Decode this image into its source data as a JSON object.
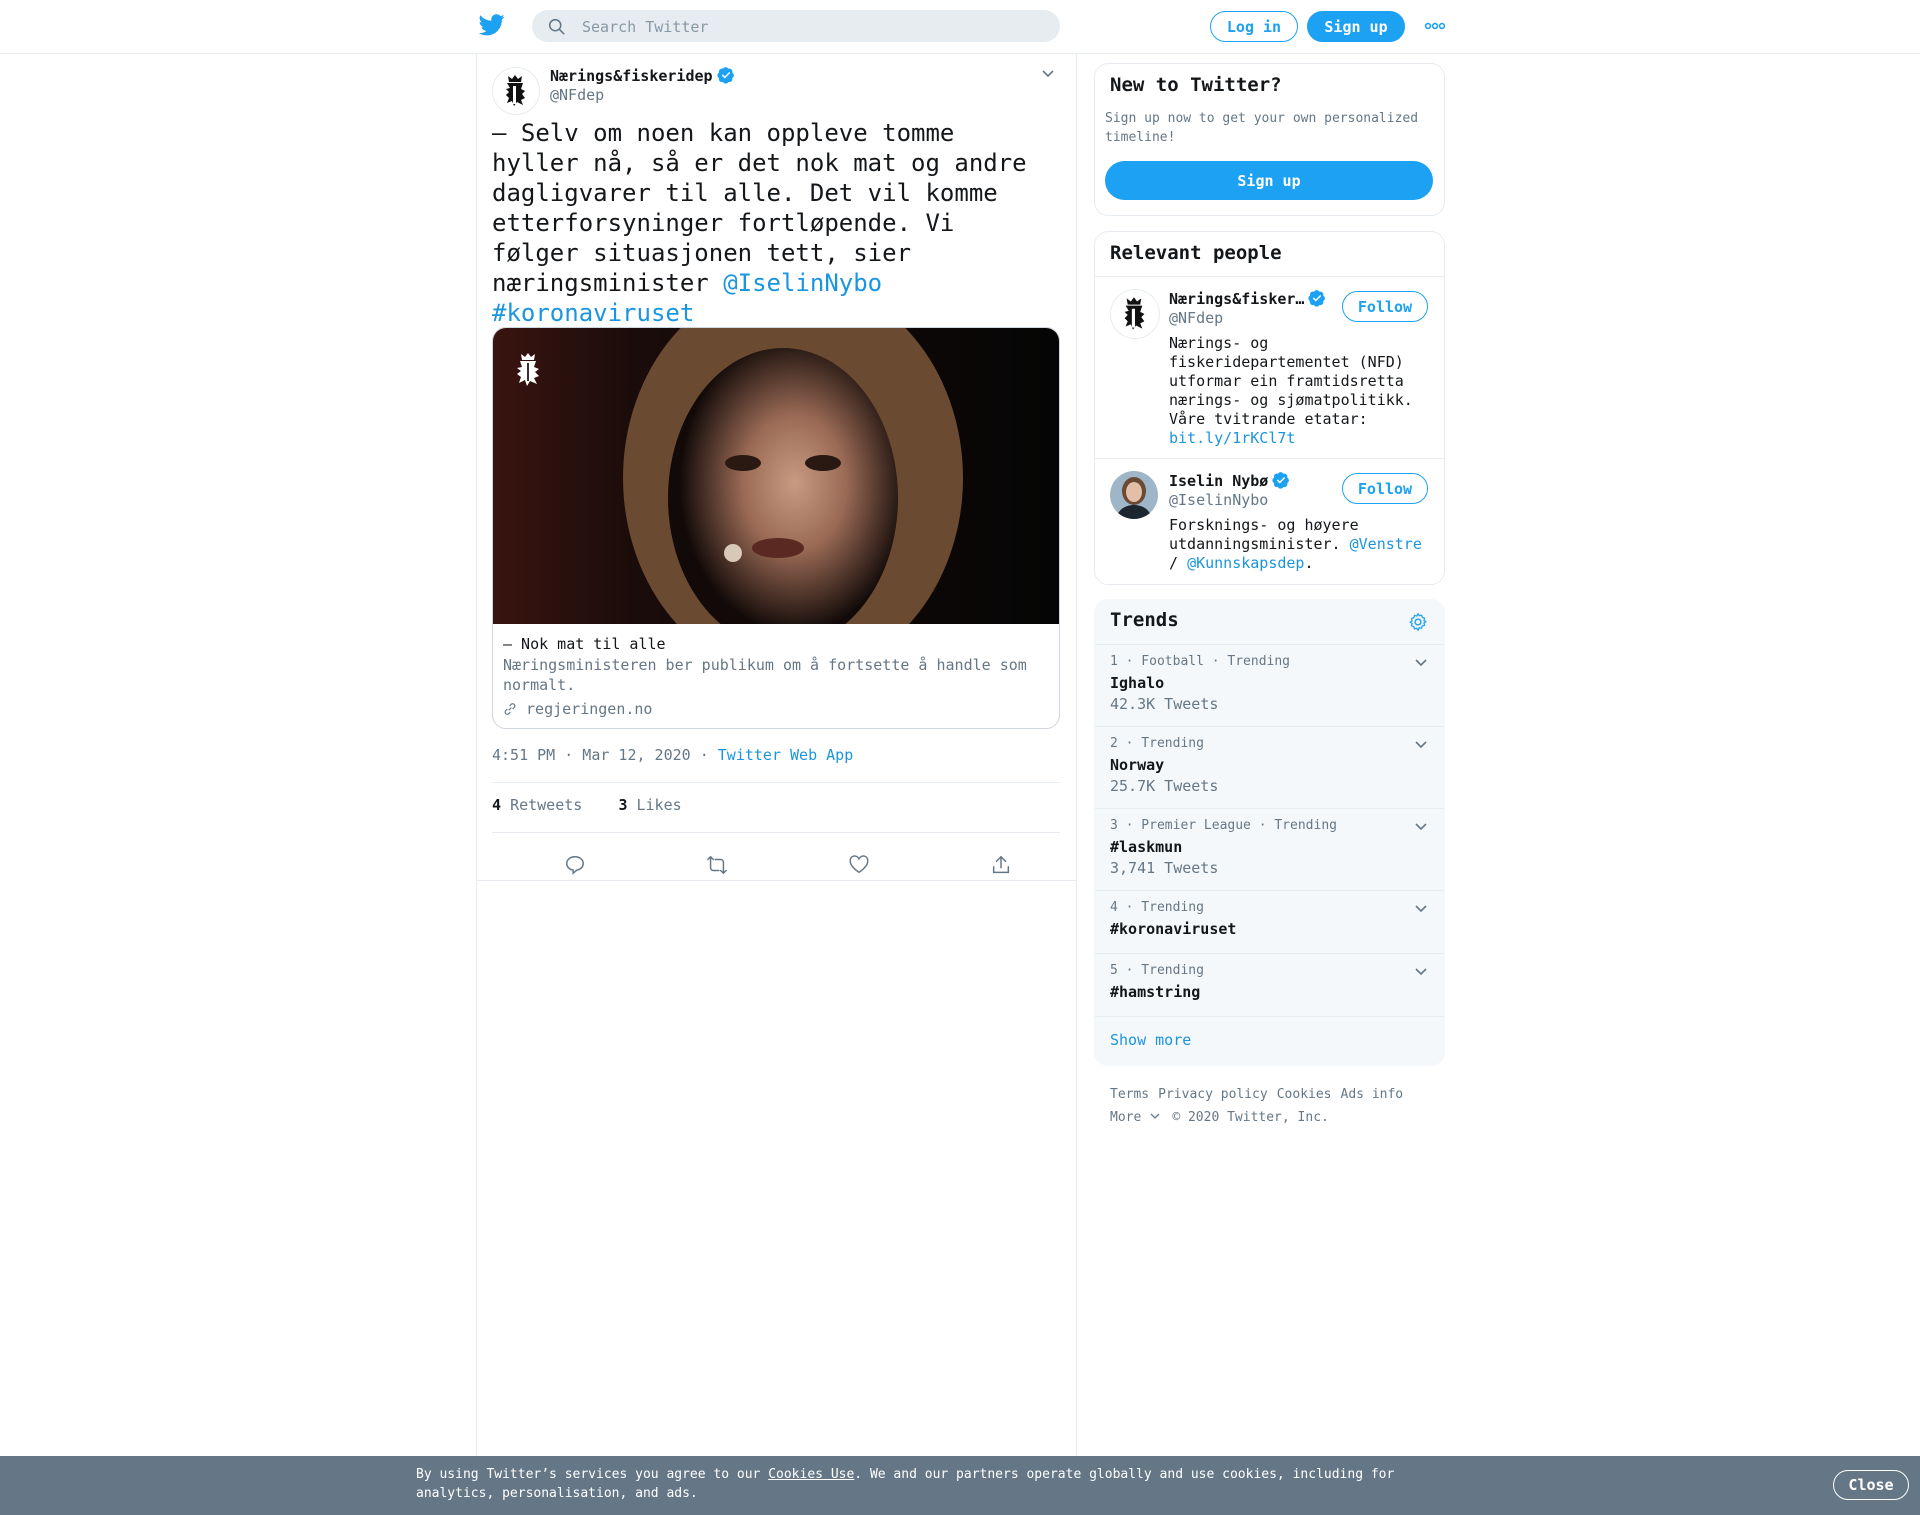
{
  "header": {
    "search_placeholder": "Search Twitter",
    "login_label": "Log in",
    "signup_label": "Sign up",
    "more_icon": "more-dots-icon",
    "brand_color": "#1da1f2"
  },
  "tweet": {
    "author_name": "Nærings&fiskeridep",
    "author_handle": "@NFdep",
    "text": "– Selv om noen kan oppleve tomme hyller nå, så er det nok mat og andre dagligvarer til alle. Det vil komme etterforsyninger fortløpende. Vi følger situasjonen tett, sier næringsminister ",
    "mention": "@IselinNybo",
    "hashtag": "#koronaviruset",
    "card": {
      "title": "– Nok mat til alle",
      "description": "Næringsministeren ber publikum om å fortsette å handle som normalt.",
      "domain": "regjeringen.no"
    },
    "time": "4:51 PM · Mar 12, 2020",
    "source_sep": " · ",
    "source": "Twitter Web App",
    "retweets_count": "4",
    "retweets_label": "Retweets",
    "likes_count": "3",
    "likes_label": "Likes"
  },
  "sidebar": {
    "new_to_twitter": {
      "title": "New to Twitter?",
      "text": "Sign up now to get your own personalized timeline!",
      "button": "Sign up"
    },
    "relevant_people": {
      "title": "Relevant people",
      "people": [
        {
          "name": "Nærings&fisker…",
          "handle": "@NFdep",
          "follow": "Follow",
          "bio": "Nærings- og fiskeridepartementet (NFD) utformar ein framtidsretta nærings- og sjømatpolitikk. Våre tvitrande etatar: ",
          "bio_link": "bit.ly/1rKCl7t"
        },
        {
          "name": "Iselin Nybø",
          "handle": "@IselinNybo",
          "follow": "Follow",
          "bio": "Forsknings- og høyere utdanningsminister. ",
          "bio_link1": "@Venstre",
          "bio_mid": " / ",
          "bio_link2": "@Kunnskapsdep",
          "bio_end": "."
        }
      ]
    },
    "trends": {
      "title": "Trends",
      "items": [
        {
          "meta": "1 · Football · Trending",
          "name": "Ighalo",
          "count": "42.3K Tweets"
        },
        {
          "meta": "2 · Trending",
          "name": "Norway",
          "count": "25.7K Tweets"
        },
        {
          "meta": "3 · Premier League · Trending",
          "name": "#laskmun",
          "count": "3,741 Tweets"
        },
        {
          "meta": "4 · Trending",
          "name": "#koronaviruset",
          "count": ""
        },
        {
          "meta": "5 · Trending",
          "name": "#hamstring",
          "count": ""
        }
      ],
      "show_more": "Show more"
    },
    "footer": {
      "links": [
        "Terms",
        "Privacy policy",
        "Cookies",
        "Ads info"
      ],
      "more": "More",
      "copyright": "© 2020 Twitter, Inc."
    }
  },
  "cookie_bar": {
    "text_before": "By using Twitter’s services you agree to our ",
    "link": "Cookies Use",
    "text_after": ". We and our partners operate globally and use cookies, including for analytics, personalisation, and ads.",
    "close": "Close"
  }
}
